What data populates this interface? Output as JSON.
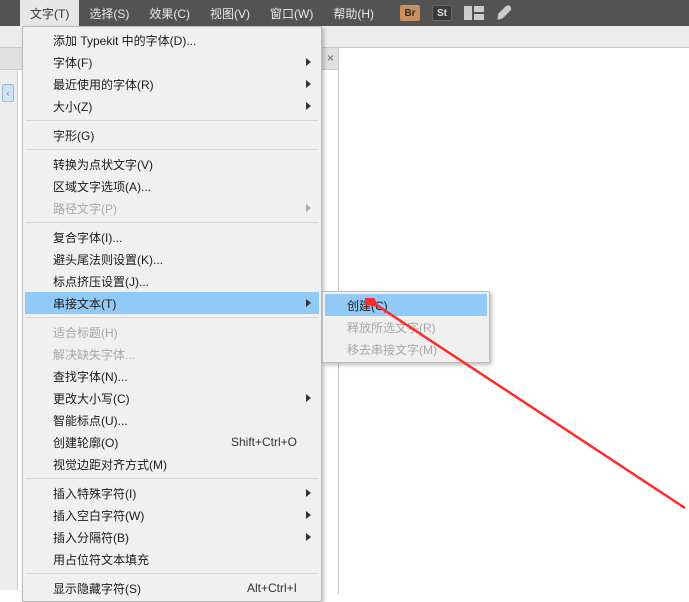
{
  "menubar": [
    {
      "label": "文字(T)",
      "active": true
    },
    {
      "label": "选择(S)"
    },
    {
      "label": "效果(C)"
    },
    {
      "label": "视图(V)"
    },
    {
      "label": "窗口(W)"
    },
    {
      "label": "帮助(H)"
    }
  ],
  "toolbar_icons": {
    "br": "Br",
    "st": "St"
  },
  "tab_x": "×",
  "sidebar_btn": "‹",
  "menu": [
    {
      "label": "添加 Typekit 中的字体(D)..."
    },
    {
      "label": "字体(F)",
      "arrow": true
    },
    {
      "label": "最近使用的字体(R)",
      "arrow": true
    },
    {
      "label": "大小(Z)",
      "arrow": true
    },
    {
      "sep": true
    },
    {
      "label": "字形(G)"
    },
    {
      "sep": true
    },
    {
      "label": "转换为点状文字(V)"
    },
    {
      "label": "区域文字选项(A)..."
    },
    {
      "label": "路径文字(P)",
      "arrow": true,
      "disabled": true
    },
    {
      "sep": true
    },
    {
      "label": "复合字体(I)..."
    },
    {
      "label": "避头尾法则设置(K)..."
    },
    {
      "label": "标点挤压设置(J)..."
    },
    {
      "label": "串接文本(T)",
      "arrow": true,
      "highlight": true
    },
    {
      "sep": true
    },
    {
      "label": "适合标题(H)",
      "disabled": true
    },
    {
      "label": "解决缺失字体...",
      "disabled": true
    },
    {
      "label": "查找字体(N)..."
    },
    {
      "label": "更改大小写(C)",
      "arrow": true
    },
    {
      "label": "智能标点(U)..."
    },
    {
      "label": "创建轮廓(O)",
      "shortcut": "Shift+Ctrl+O"
    },
    {
      "label": "视觉边距对齐方式(M)"
    },
    {
      "sep": true
    },
    {
      "label": "插入特殊字符(I)",
      "arrow": true
    },
    {
      "label": "插入空白字符(W)",
      "arrow": true
    },
    {
      "label": "插入分隔符(B)",
      "arrow": true
    },
    {
      "label": "用占位符文本填充"
    },
    {
      "sep": true
    },
    {
      "label": "显示隐藏字符(S)",
      "shortcut": "Alt+Ctrl+I"
    }
  ],
  "submenu": [
    {
      "label": "创建(C)",
      "highlight": true
    },
    {
      "label": "释放所选文字(R)",
      "disabled": true
    },
    {
      "label": "移去串接文字(M)",
      "disabled": true
    }
  ]
}
